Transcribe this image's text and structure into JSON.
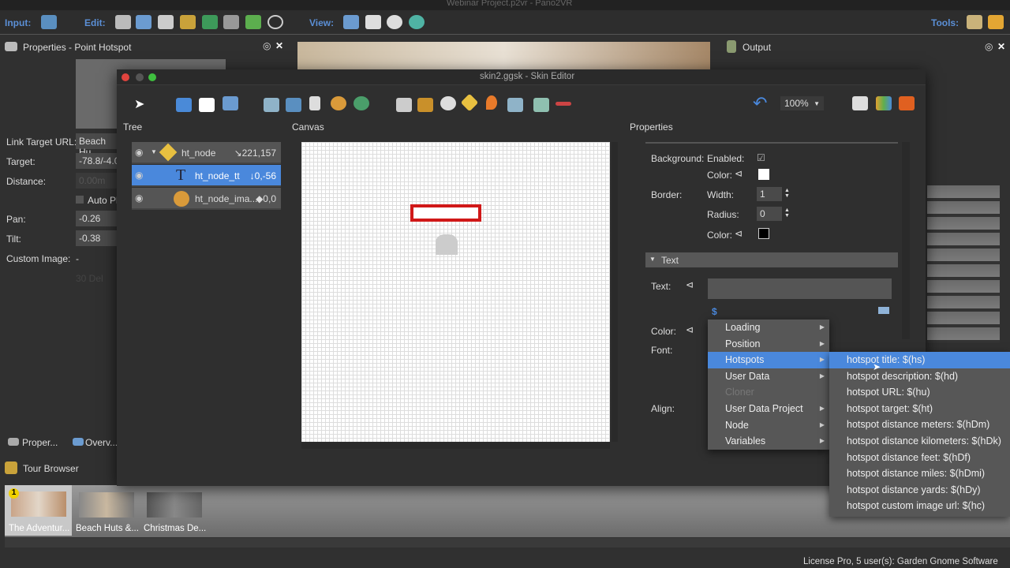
{
  "app": {
    "title": "Webinar Project.p2vr - Pano2VR"
  },
  "toolbar": {
    "input": "Input:",
    "edit": "Edit:",
    "view": "View:",
    "tools": "Tools:"
  },
  "left_panel": {
    "title": "Properties - Point Hotspot",
    "fields": [
      {
        "label": "Link Target URL:",
        "value": "Beach Hu"
      },
      {
        "label": "Target:",
        "value": "-78.8/-4.0"
      },
      {
        "label": "Distance:",
        "value": "0.00m"
      },
      {
        "label": "Pan:",
        "value": "-0.26"
      },
      {
        "label": "Tilt:",
        "value": "-0.38"
      },
      {
        "label": "Custom Image:",
        "value": "-"
      }
    ],
    "auto_label": "Auto Pl",
    "faded": "30 Del"
  },
  "bottom_tabs": [
    "Proper...",
    "Overv..."
  ],
  "tour_browser": {
    "title": "Tour Browser",
    "items": [
      {
        "label": "The Adventur...",
        "badge": "1",
        "selected": true
      },
      {
        "label": "Beach Huts &..."
      },
      {
        "label": "Christmas De..."
      }
    ]
  },
  "output_panel": {
    "title": "Output"
  },
  "status_bar": "License Pro, 5 user(s): Garden Gnome Software",
  "skin_editor": {
    "title": "skin2.ggsk - Skin Editor",
    "zoom": "100%",
    "tree_label": "Tree",
    "canvas_label": "Canvas",
    "properties_label": "Properties",
    "tree": [
      {
        "name": "ht_node",
        "pos": "↘221,157",
        "icon": "hotspot-icon"
      },
      {
        "name": "ht_node_tt",
        "pos": "↓0,-56",
        "icon": "text-icon",
        "selected": true
      },
      {
        "name": "ht_node_ima...",
        "pos": "◆0,0",
        "icon": "image-icon"
      }
    ],
    "props": {
      "background": "Background:",
      "enabled": "Enabled:",
      "color": "Color:",
      "border": "Border:",
      "width": "Width:",
      "width_value": "1",
      "radius": "Radius:",
      "radius_value": "0",
      "section_text": "Text",
      "text": "Text:",
      "font": "Font:",
      "align": "Align:",
      "dollar": "$"
    },
    "colors": {
      "bg_color": "#ffffff",
      "border_color": "#000000",
      "accent": "#4a88dc"
    }
  },
  "context_menu": {
    "items": [
      {
        "label": "Loading",
        "sub": true
      },
      {
        "label": "Position",
        "sub": true
      },
      {
        "label": "Hotspots",
        "sub": true,
        "selected": true
      },
      {
        "label": "User Data",
        "sub": true
      },
      {
        "label": "Cloner",
        "disabled": true
      },
      {
        "label": "User Data Project",
        "sub": true
      },
      {
        "label": "Node",
        "sub": true
      },
      {
        "label": "Variables",
        "sub": true
      }
    ],
    "submenu": [
      "hotspot title: $(hs)",
      "hotspot description: $(hd)",
      "hotspot URL: $(hu)",
      "hotspot target: $(ht)",
      "hotspot distance meters: $(hDm)",
      "hotspot distance kilometers: $(hDk)",
      "hotspot distance feet: $(hDf)",
      "hotspot distance miles: $(hDmi)",
      "hotspot distance yards: $(hDy)",
      "hotspot custom image url: $(hc)"
    ]
  }
}
